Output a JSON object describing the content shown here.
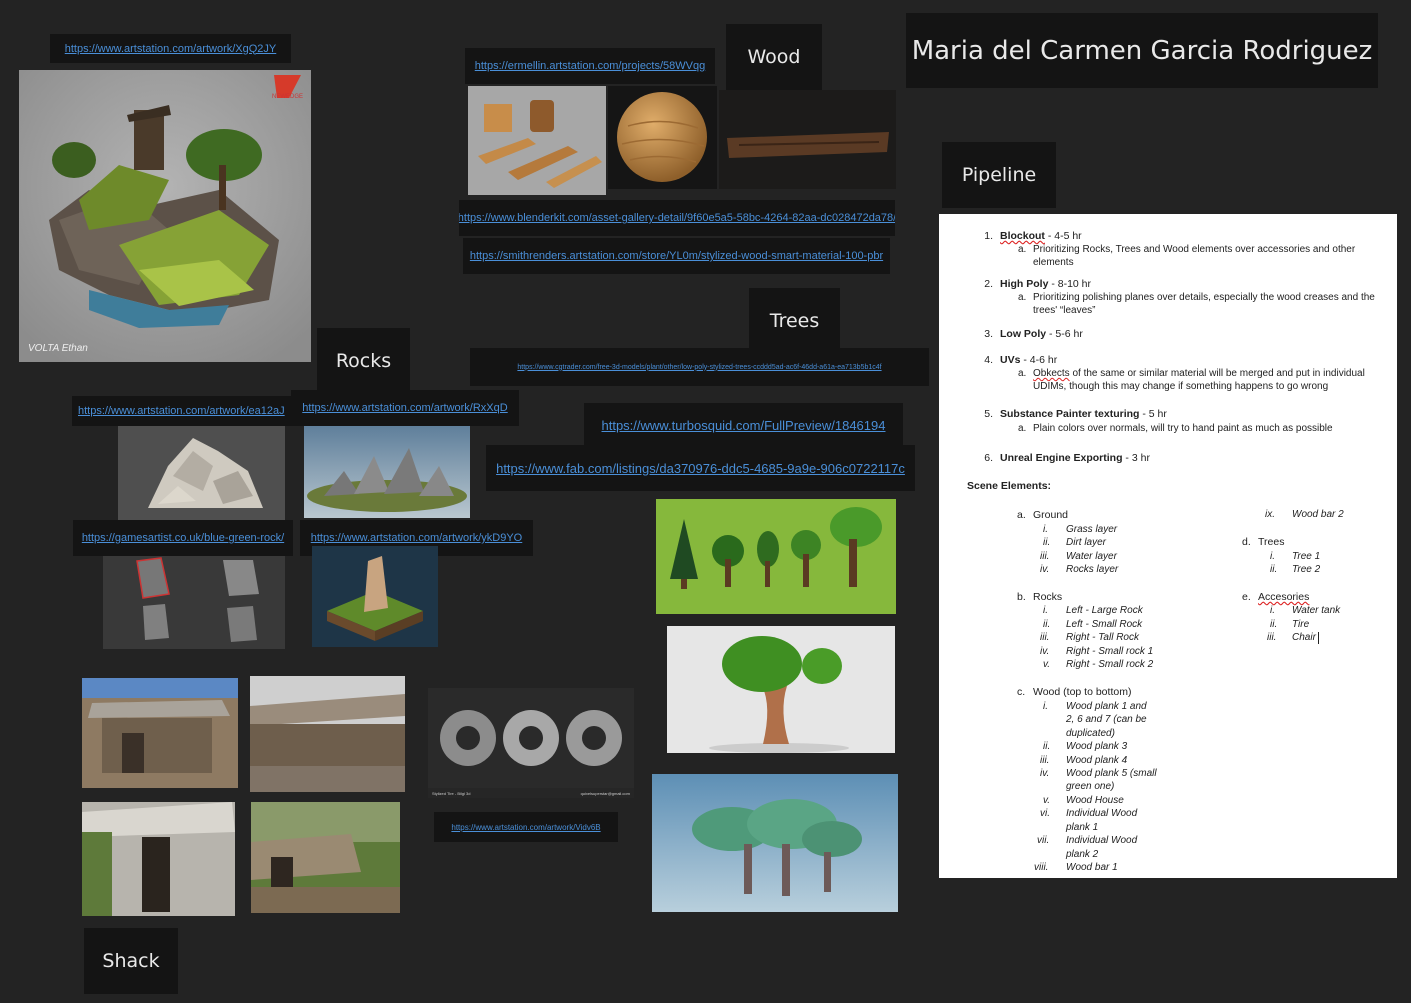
{
  "title": "Maria del Carmen Garcia Rodriguez",
  "sections": {
    "wood": "Wood",
    "trees": "Trees",
    "rocks": "Rocks",
    "shack": "Shack",
    "pipeline": "Pipeline"
  },
  "links": {
    "xgq2jy": "https://www.artstation.com/artwork/XgQ2JY",
    "ermellin": "https://ermellin.artstation.com/projects/58WVqg",
    "blenderkit": "https://www.blenderkit.com/asset-gallery-detail/9f60e5a5-58bc-4264-82aa-dc028472da78/",
    "smithrenders": "https://smithrenders.artstation.com/store/YL0m/stylized-wood-smart-material-100-pbr",
    "cgtrader": "https://www.cgtrader.com/free-3d-models/plant/other/low-poly-stylized-trees-ccddd5ad-ac6f-46dd-a61a-ea713b5b1c4f",
    "turbosquid": "https://www.turbosquid.com/FullPreview/1846194",
    "fab": "https://www.fab.com/listings/da370976-ddc5-4685-9a9e-906c0722117c",
    "ea12aj": "https://www.artstation.com/artwork/ea12aJ",
    "rxxqd": "https://www.artstation.com/artwork/RxXqD",
    "gamesartist": "https://gamesartist.co.uk/blue-green-rock/",
    "ykd9yo": "https://www.artstation.com/artwork/ykD9YO",
    "vidv6b": "https://www.artstation.com/artwork/Vidv6B"
  },
  "image_text": {
    "volta": "VOLTA Ethan",
    "newedge": "NEWEDGE",
    "tire_caption_left": "Stylized Tire - Bilgi 3d",
    "tire_caption_right": "quixelsuperstar@gmail.com"
  },
  "doc": {
    "steps": [
      {
        "num": "1.",
        "name": "Blockout",
        "time": " - 4-5 hr",
        "sub": [
          "Prioritizing Rocks, Trees and Wood elements over accessories and other",
          "elements"
        ]
      },
      {
        "num": "2.",
        "name": "High Poly",
        "time": " - 8-10 hr",
        "sub": [
          "Prioritizing polishing planes over details, especially the wood creases and the",
          "trees' “leaves”"
        ]
      },
      {
        "num": "3.",
        "name": "Low Poly",
        "time": " - 5-6 hr",
        "sub": []
      },
      {
        "num": "4.",
        "name": "UVs",
        "time": " - 4-6 hr",
        "sub_first": "Obkects",
        "sub_rest": " of the same or similar material will be merged and put in individual",
        "sub": [
          "UDIMs, though this may change if something happens to go wrong"
        ]
      },
      {
        "num": "5.",
        "name": "Substance Painter texturing",
        "time": " - 5 hr",
        "sub": [
          "Plain colors over normals, will try to hand paint as much as possible"
        ]
      },
      {
        "num": "6.",
        "name": "Unreal Engine Exporting",
        "time": " - 3 hr",
        "sub": []
      }
    ],
    "sub_letter": "a.",
    "scene_title": "Scene Elements:",
    "ground": {
      "letter": "a.",
      "name": "Ground",
      "items": [
        [
          "i.",
          "Grass layer"
        ],
        [
          "ii.",
          "Dirt layer"
        ],
        [
          "iii.",
          "Water layer"
        ],
        [
          "iv.",
          "Rocks layer"
        ]
      ]
    },
    "rocks": {
      "letter": "b.",
      "name": "Rocks",
      "items": [
        [
          "i.",
          "Left - Large Rock"
        ],
        [
          "ii.",
          "Left - Small Rock"
        ],
        [
          "iii.",
          "Right - Tall Rock"
        ],
        [
          "iv.",
          "Right - Small rock 1"
        ],
        [
          "v.",
          "Right - Small rock 2"
        ]
      ]
    },
    "wood": {
      "letter": "c.",
      "name": "Wood (top to bottom)",
      "items": [
        [
          "i.",
          "Wood plank 1 and"
        ],
        [
          "",
          "2, 6 and 7 (can be"
        ],
        [
          "",
          "duplicated)"
        ],
        [
          "ii.",
          "Wood plank 3"
        ],
        [
          "iii.",
          "Wood plank 4"
        ],
        [
          "iv.",
          "Wood plank 5 (small"
        ],
        [
          "",
          "green one)"
        ],
        [
          "v.",
          "Wood House"
        ],
        [
          "vi.",
          "Individual Wood"
        ],
        [
          "",
          "plank 1"
        ],
        [
          "vii.",
          "Individual Wood"
        ],
        [
          "",
          "plank 2"
        ],
        [
          "viii.",
          "Wood bar 1"
        ]
      ]
    },
    "wood_ix": [
      "ix.",
      "Wood bar 2"
    ],
    "trees": {
      "letter": "d.",
      "name": "Trees",
      "items": [
        [
          "i.",
          "Tree 1"
        ],
        [
          "ii.",
          "Tree 2"
        ]
      ]
    },
    "acc": {
      "letter": "e.",
      "name": "Accesories",
      "items": [
        [
          "i.",
          "Water tank"
        ],
        [
          "ii.",
          "Tire"
        ],
        [
          "iii.",
          "Chair"
        ]
      ]
    }
  },
  "colors": {
    "background": "#232323",
    "panel": "#141414",
    "link": "#4a8fd8"
  }
}
